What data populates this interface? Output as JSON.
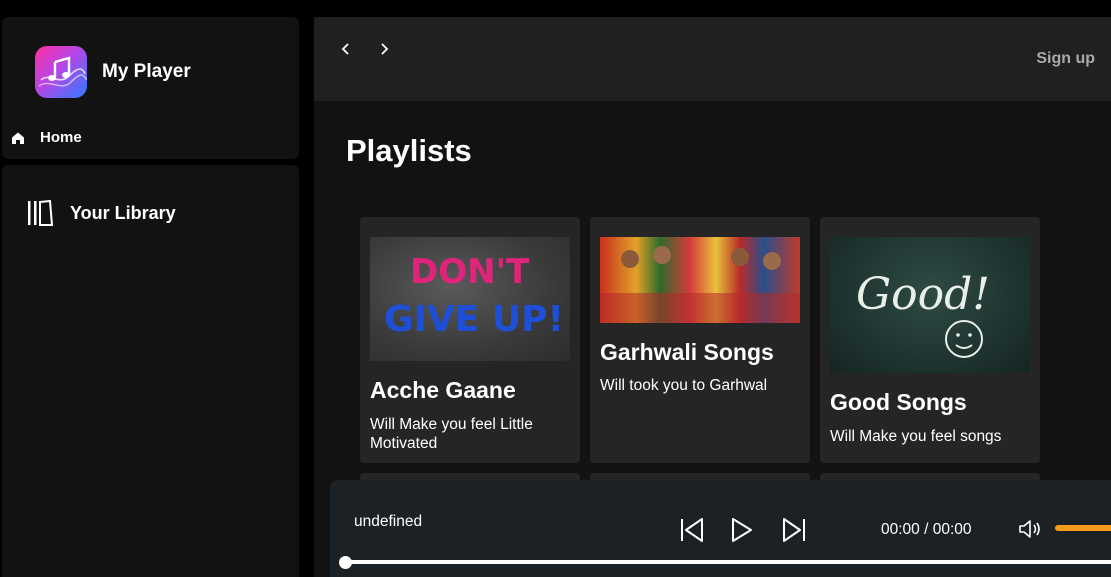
{
  "sidebar": {
    "app_title": "My Player",
    "home_label": "Home",
    "library_label": "Your Library"
  },
  "header": {
    "back_icon": "chevron-left-icon",
    "forward_icon": "chevron-right-icon",
    "signup_label": "Sign up"
  },
  "main": {
    "section_title": "Playlists",
    "playlists": [
      {
        "title": "Acche Gaane",
        "description": "Will Make you feel Little Motivated",
        "image_text": [
          "DON'T",
          "GIVE UP!"
        ]
      },
      {
        "title": "Garhwali Songs",
        "description": "Will took you to Garhwal"
      },
      {
        "title": "Good Songs",
        "description": "Will Make you feel songs",
        "image_text": [
          "Good!"
        ]
      }
    ]
  },
  "player": {
    "song_name": "undefined",
    "time": "00:00 / 00:00",
    "progress": 0,
    "volume": 1.0
  },
  "colors": {
    "accent": "#f59a1b",
    "panel": "#121212",
    "card": "#252525",
    "player_bg": "#1c2125"
  }
}
